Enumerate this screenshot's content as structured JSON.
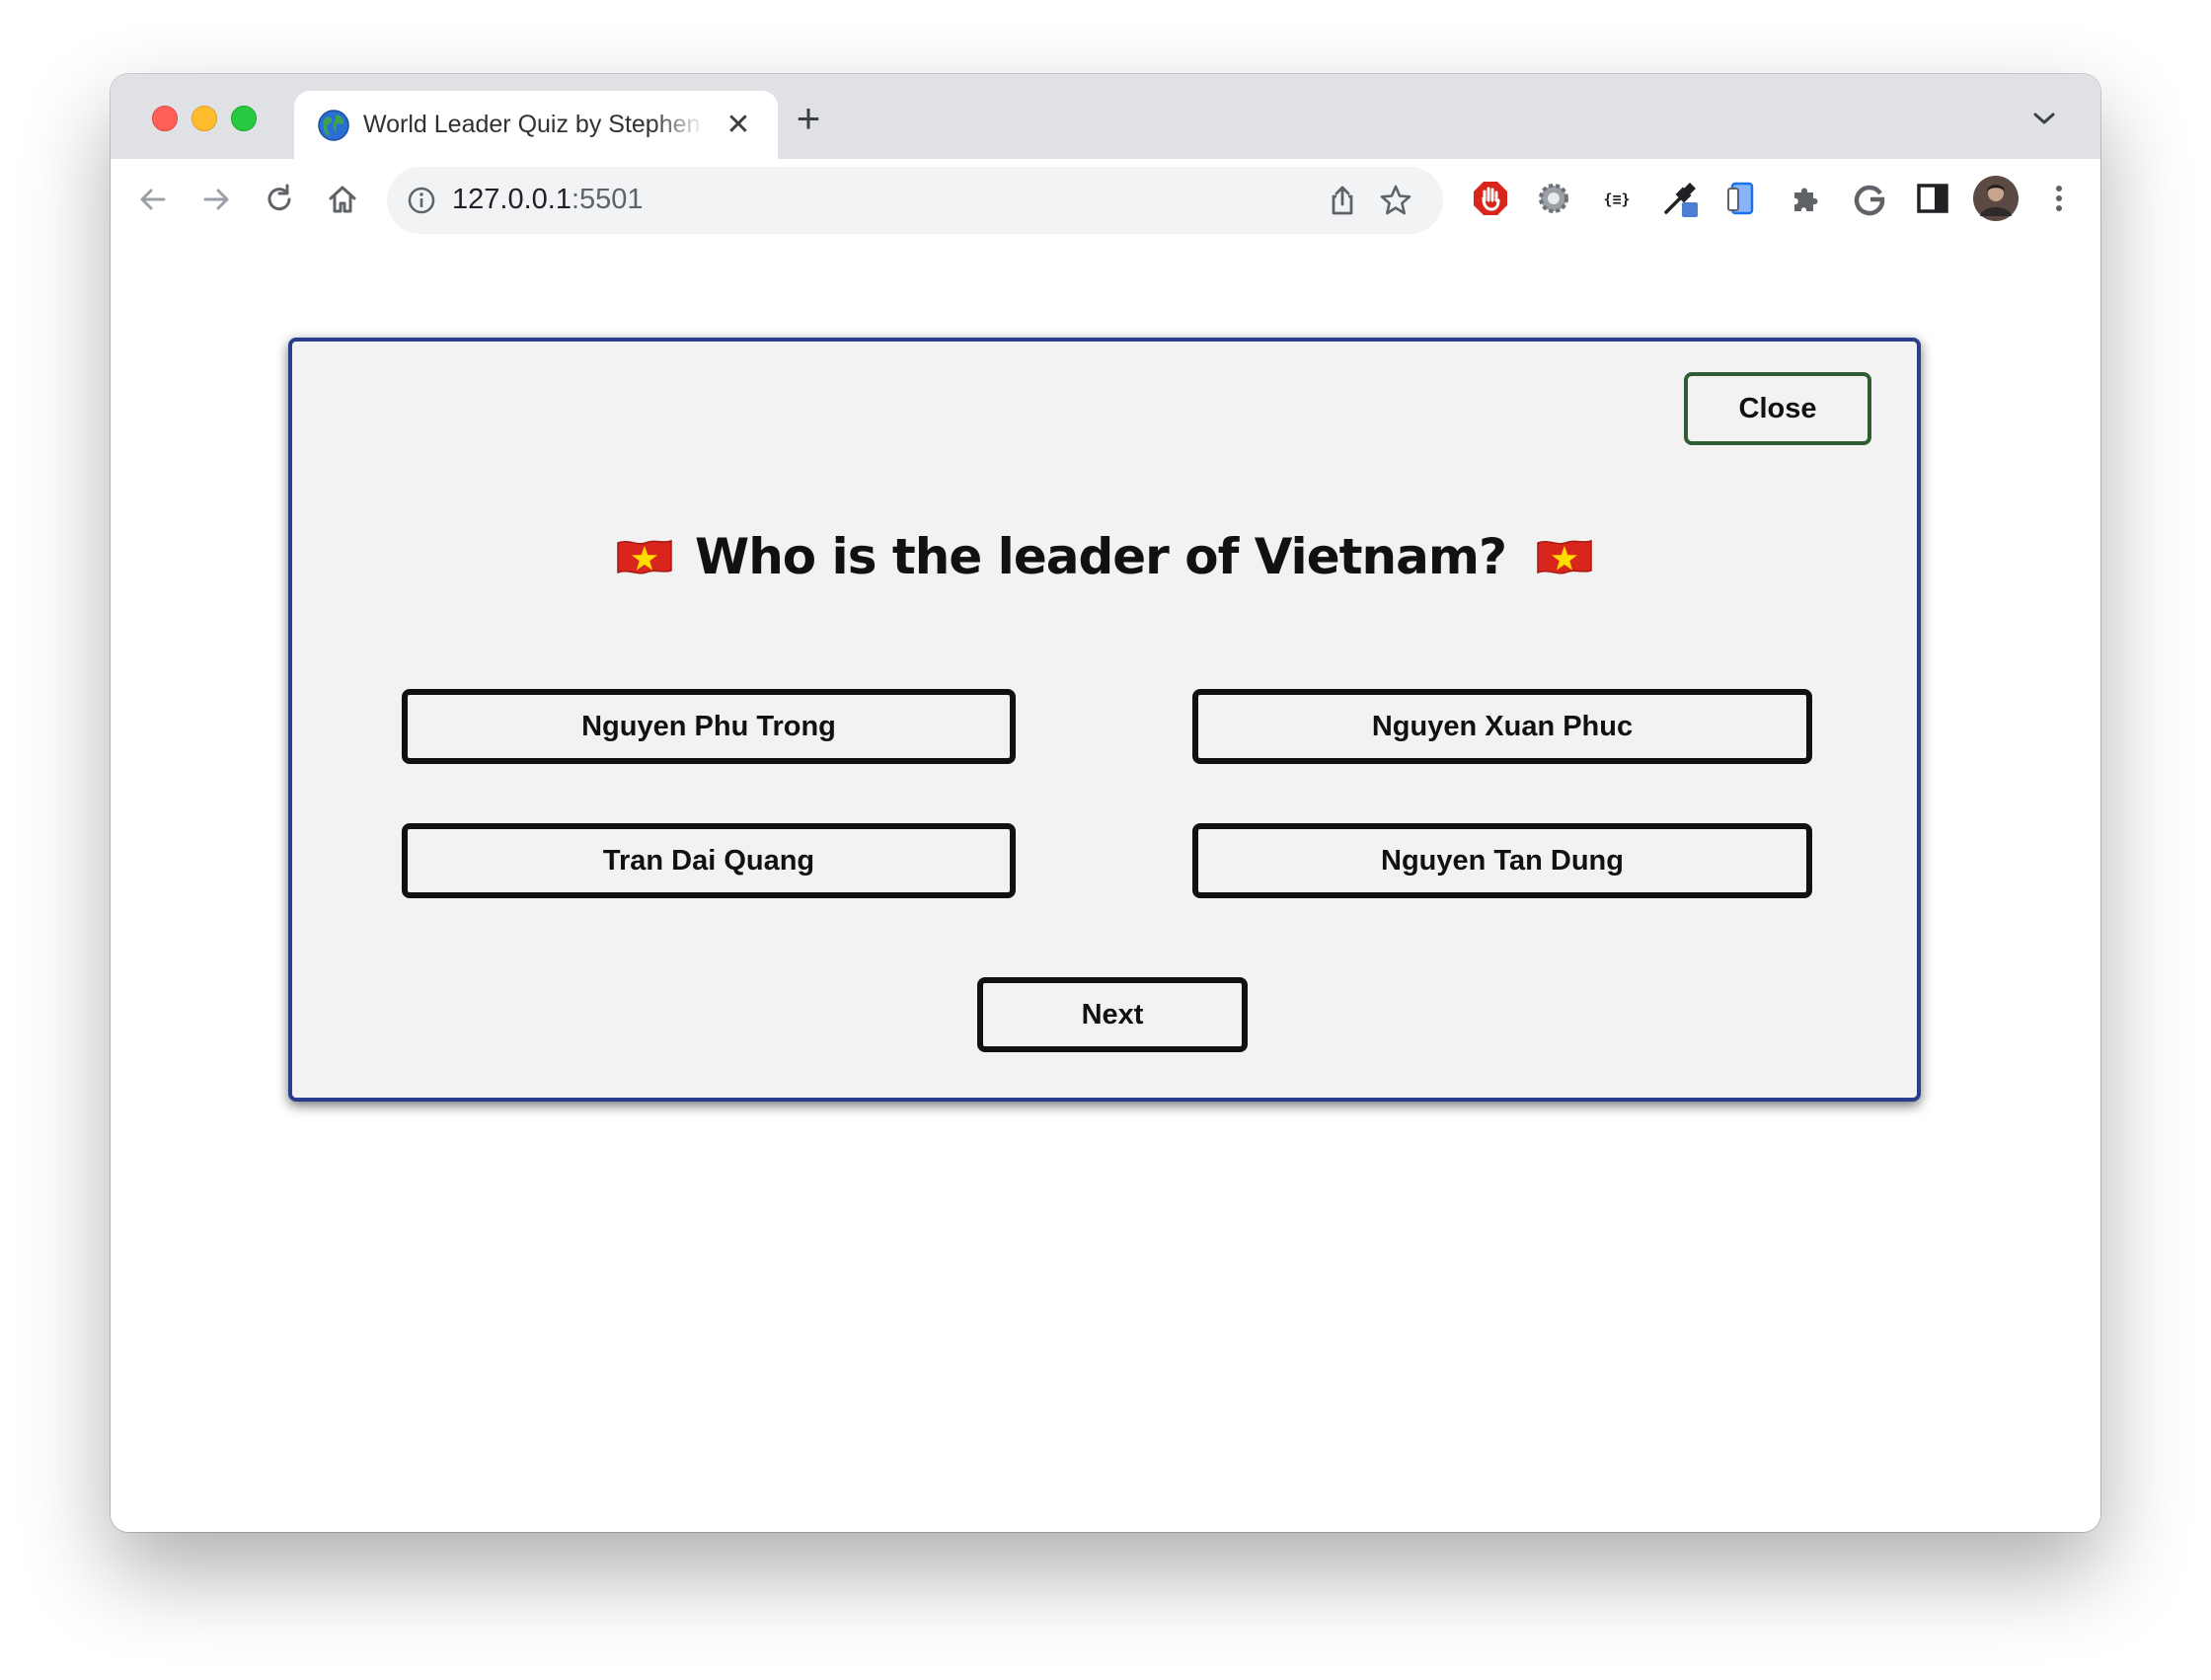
{
  "browser": {
    "tab_title": "World Leader Quiz by Stephen",
    "tab_close": "✕",
    "new_tab": "+",
    "url_host": "127.0.0.1",
    "url_port": ":5501"
  },
  "icons": {
    "tab_favicon": "globe-icon",
    "back": "back-arrow-icon",
    "forward": "forward-arrow-icon",
    "reload": "reload-icon",
    "home": "home-icon",
    "site_info": "info-icon",
    "share": "share-icon",
    "bookmark": "star-icon",
    "extensions": [
      "adblock-icon",
      "settings-gear-icon",
      "json-formatter-icon",
      "color-picker-icon",
      "device-icon",
      "puzzle-icon",
      "google-icon",
      "side-panel-icon",
      "profile-avatar",
      "kebab-menu-icon"
    ],
    "flag": "vietnam-flag-icon"
  },
  "colors": {
    "card_border": "#2a3d8c",
    "card_background": "#f2f2f2",
    "close_border": "#2f5e35",
    "button_border": "#111111",
    "flag_red": "#da251d",
    "flag_star": "#ffdd00"
  },
  "quiz": {
    "close_label": "Close",
    "question": "Who is the leader of Vietnam?",
    "options": [
      "Nguyen Phu Trong",
      "Nguyen Xuan Phuc",
      "Tran Dai Quang",
      "Nguyen Tan Dung"
    ],
    "next_label": "Next"
  }
}
